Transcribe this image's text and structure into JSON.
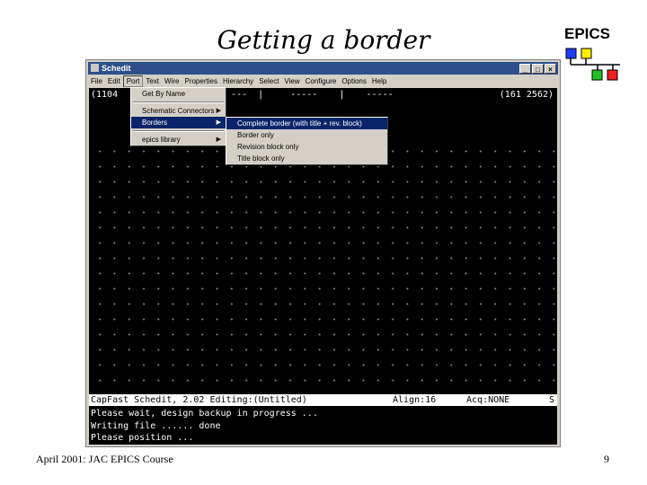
{
  "slide": {
    "title": "Getting a border",
    "epics_label": "EPICS",
    "footer_left": "April 2001: JAC EPICS Course",
    "page_number": "9"
  },
  "window": {
    "title": "Schedit",
    "buttons": [
      "_",
      "□",
      "×"
    ],
    "menubar": [
      "File",
      "Edit",
      "Port",
      "Text",
      "Wire",
      "Properties",
      "Hierarchy",
      "Select",
      "View",
      "Configure",
      "Options",
      "Help"
    ],
    "active_menu": "Port"
  },
  "port_menu": {
    "items": [
      {
        "label": "Get By Name",
        "has_submenu": false
      },
      {
        "label": "Schematic Connectors",
        "has_submenu": true
      },
      {
        "label": "Borders",
        "has_submenu": true,
        "selected": true
      },
      {
        "label": "epics library",
        "has_submenu": true
      }
    ]
  },
  "borders_submenu": {
    "items": [
      {
        "label": "Complete border (with title + rev. block)",
        "selected": true
      },
      {
        "label": "Border only"
      },
      {
        "label": "Revision block only"
      },
      {
        "label": "Title block only"
      }
    ]
  },
  "canvas": {
    "coord_left": "(1104",
    "coord_right": "(161 2562)",
    "top_fields": "---  |     -----    |    -----",
    "status": {
      "app": "CapFast Schedit, 2.02 Editing:(Untitled)",
      "align": "Align:16",
      "acq": "Acq:NONE",
      "extra": "S"
    },
    "messages": [
      "Please wait, design backup in progress ...",
      "Writing file ...... done",
      "Please position ..."
    ]
  },
  "colors": {
    "canvas_bg": "#000000",
    "titlebar": "#2f4f8a",
    "menu_highlight": "#0a246a",
    "logo_blue": "#1e3cff",
    "logo_yellow": "#ffee00",
    "logo_green": "#22c022",
    "logo_red": "#ee2020"
  }
}
